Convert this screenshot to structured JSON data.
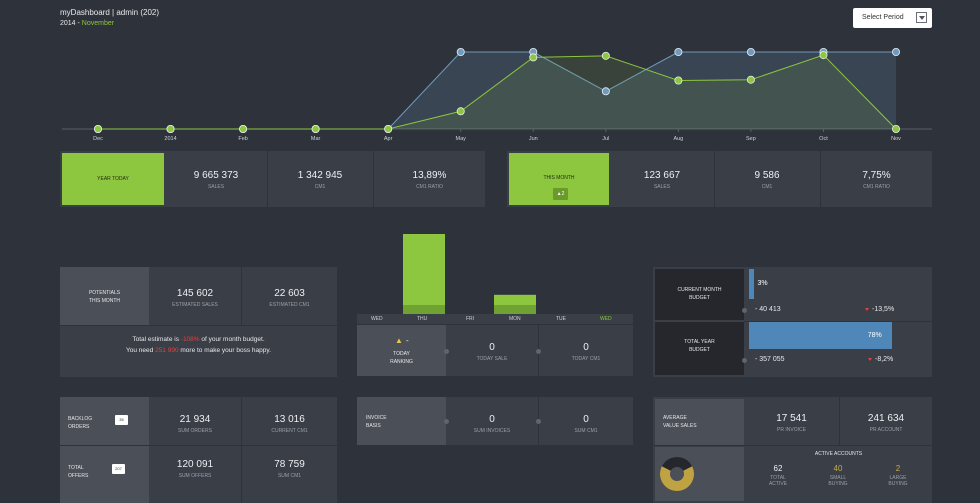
{
  "header": {
    "title": "myDashboard | admin (202)",
    "year": "2014 - ",
    "month": "November"
  },
  "period_select": {
    "label": "Select Period"
  },
  "chart_data": {
    "type": "line",
    "categories": [
      "Dec",
      "2014",
      "Feb",
      "Mar",
      "Apr",
      "May",
      "Jun",
      "Jul",
      "Aug",
      "Sep",
      "Oct",
      "Nov"
    ],
    "series": [
      {
        "values": [
          0,
          0,
          0,
          0,
          0,
          100,
          100,
          49,
          100,
          100,
          100,
          100
        ],
        "color": "#6f9bbf"
      },
      {
        "values": [
          0,
          0,
          0,
          0,
          0,
          23,
          93,
          95,
          63,
          64,
          96,
          0
        ],
        "color": "#8dc63f"
      }
    ],
    "ylim": [
      0,
      100
    ],
    "grid": false
  },
  "year_today": {
    "label": "YEAR TODAY",
    "stats": [
      {
        "value": "9 665 373",
        "label": "SALES"
      },
      {
        "value": "1 342 945",
        "label": "CM1"
      },
      {
        "value": "13,89%",
        "label": "CM1 RATIO"
      }
    ]
  },
  "this_month": {
    "label": "THIS MONTH",
    "badge": "2",
    "stats": [
      {
        "value": "123 667",
        "label": "SALES"
      },
      {
        "value": "9 586",
        "label": "CM1"
      },
      {
        "value": "7,75%",
        "label": "CM1 RATIO"
      }
    ]
  },
  "potentials": {
    "label": "POTENTIALS\nTHIS MONTH",
    "stats": [
      {
        "value": "145 602",
        "label": "ESTIMATED SALES"
      },
      {
        "value": "22 603",
        "label": "ESTIMATED CM1"
      }
    ],
    "line1_a": "Total estimate is ",
    "line1_b": "-108%",
    "line1_c": " of your month budget.",
    "line2_a": "You need ",
    "line2_b": "251 990",
    "line2_c": " more to make your boss happy."
  },
  "weekday_chart": {
    "days": [
      "WED",
      "THU",
      "FRI",
      "MON",
      "TUE",
      "WED"
    ],
    "bars": [
      0,
      100,
      0,
      24,
      0,
      0
    ],
    "highlight": 5,
    "ranking_label": "TODAY\nRANKING",
    "ranking_value": "-",
    "stats": [
      {
        "value": "0",
        "label": "TODAY SALE"
      },
      {
        "value": "0",
        "label": "TODAY CM1"
      }
    ]
  },
  "budget": {
    "month_label": "CURRENT MONTH\nBUDGET",
    "month_pct": "3%",
    "month_progress": 3,
    "month_diff": "- 40 413",
    "month_change": "-13,5%",
    "year_label": "TOTAL YEAR\nBUDGET",
    "year_pct": "78%",
    "year_progress": 78,
    "year_diff": "- 357 055",
    "year_change": "-8,2%"
  },
  "orders": {
    "backlog_label": "BACKLOG\nORDERS",
    "backlog_badge": "35",
    "backlog_stats": [
      {
        "value": "21 934",
        "label": "SUM ORDERS"
      },
      {
        "value": "13 016",
        "label": "CURRENT CM1"
      }
    ],
    "offers_label": "TOTAL\nOFFERS",
    "offers_badge": "207",
    "offers_stats": [
      {
        "value": "120 091",
        "label": "SUM OFFERS"
      },
      {
        "value": "78 759",
        "label": "SUM CM1"
      }
    ]
  },
  "invoice": {
    "label": "INVOICE\nBASIS",
    "stats": [
      {
        "value": "0",
        "label": "SUM INVOICES"
      },
      {
        "value": "0",
        "label": "SUM CM1"
      }
    ]
  },
  "average": {
    "label": "AVERAGE\nVALUE SALES",
    "stats": [
      {
        "value": "17 541",
        "label": "PR INVOICE"
      },
      {
        "value": "241 634",
        "label": "PR ACCOUNT"
      }
    ],
    "accounts_title": "ACTIVE ACCOUNTS",
    "accounts": [
      {
        "value": "62",
        "label": "TOTAL\nACTIVE",
        "color": "#eef0f2"
      },
      {
        "value": "40",
        "label": "SMALL\nBUYING",
        "color": "#c8a94a"
      },
      {
        "value": "2",
        "label": "LARGE\nBUYING",
        "color": "#c8a94a"
      }
    ],
    "donut": {
      "small_share": 65,
      "colors": [
        "#bfa342",
        "#25272c"
      ]
    }
  }
}
